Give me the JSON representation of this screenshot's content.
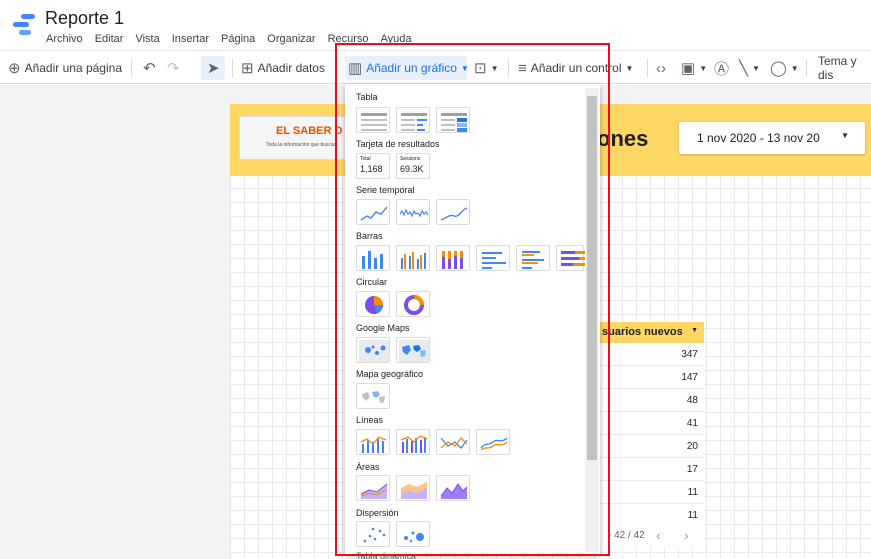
{
  "app": {
    "title": "Reporte 1",
    "menu": [
      "Archivo",
      "Editar",
      "Vista",
      "Insertar",
      "Página",
      "Organizar",
      "Recurso",
      "Ayuda"
    ]
  },
  "toolbar": {
    "add_page": "Añadir una página",
    "add_data": "Añadir datos",
    "add_chart": "Añadir un gráfico",
    "add_control": "Añadir un control",
    "theme": "Tema y dis"
  },
  "report": {
    "banner_logo_line1": "EL SABER D",
    "banner_logo_line2": "Toda la información que buscas",
    "banner_title": "ones",
    "date_range": "1 nov 2020 - 13 nov 20",
    "table_header": "suarios nuevos",
    "table_values": [
      "347",
      "147",
      "48",
      "41",
      "20",
      "17",
      "11",
      "11"
    ],
    "pager": "- 42 / 42"
  },
  "chart_menu": {
    "sections": [
      {
        "label": "Tabla"
      },
      {
        "label": "Tarjeta de resultados",
        "scorecards": [
          {
            "label": "Total",
            "value": "1,168"
          },
          {
            "label": "Sessions",
            "value": "69.3K"
          }
        ]
      },
      {
        "label": "Serie temporal"
      },
      {
        "label": "Barras"
      },
      {
        "label": "Circular"
      },
      {
        "label": "Google Maps"
      },
      {
        "label": "Mapa geográfico"
      },
      {
        "label": "Líneas"
      },
      {
        "label": "Áreas"
      },
      {
        "label": "Dispersión"
      }
    ],
    "partial_next_label": "Tabla dinámica"
  },
  "colors": {
    "accent": "#1a73e8",
    "banner": "#fdd663",
    "highlight_box": "#e5101c",
    "chart_blue": "#4285f4",
    "chart_orange": "#fb8c00",
    "chart_purple": "#7b4cf0"
  }
}
